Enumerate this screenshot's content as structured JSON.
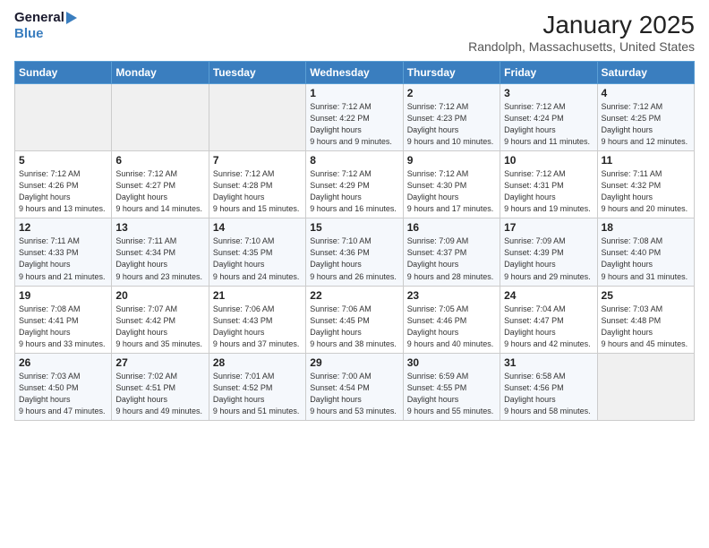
{
  "header": {
    "logo_general": "General",
    "logo_blue": "Blue",
    "month": "January 2025",
    "location": "Randolph, Massachusetts, United States"
  },
  "days_of_week": [
    "Sunday",
    "Monday",
    "Tuesday",
    "Wednesday",
    "Thursday",
    "Friday",
    "Saturday"
  ],
  "weeks": [
    [
      {
        "day": "",
        "empty": true
      },
      {
        "day": "",
        "empty": true
      },
      {
        "day": "",
        "empty": true
      },
      {
        "day": "1",
        "sunrise": "7:12 AM",
        "sunset": "4:22 PM",
        "daylight": "9 hours and 9 minutes."
      },
      {
        "day": "2",
        "sunrise": "7:12 AM",
        "sunset": "4:23 PM",
        "daylight": "9 hours and 10 minutes."
      },
      {
        "day": "3",
        "sunrise": "7:12 AM",
        "sunset": "4:24 PM",
        "daylight": "9 hours and 11 minutes."
      },
      {
        "day": "4",
        "sunrise": "7:12 AM",
        "sunset": "4:25 PM",
        "daylight": "9 hours and 12 minutes."
      }
    ],
    [
      {
        "day": "5",
        "sunrise": "7:12 AM",
        "sunset": "4:26 PM",
        "daylight": "9 hours and 13 minutes."
      },
      {
        "day": "6",
        "sunrise": "7:12 AM",
        "sunset": "4:27 PM",
        "daylight": "9 hours and 14 minutes."
      },
      {
        "day": "7",
        "sunrise": "7:12 AM",
        "sunset": "4:28 PM",
        "daylight": "9 hours and 15 minutes."
      },
      {
        "day": "8",
        "sunrise": "7:12 AM",
        "sunset": "4:29 PM",
        "daylight": "9 hours and 16 minutes."
      },
      {
        "day": "9",
        "sunrise": "7:12 AM",
        "sunset": "4:30 PM",
        "daylight": "9 hours and 17 minutes."
      },
      {
        "day": "10",
        "sunrise": "7:12 AM",
        "sunset": "4:31 PM",
        "daylight": "9 hours and 19 minutes."
      },
      {
        "day": "11",
        "sunrise": "7:11 AM",
        "sunset": "4:32 PM",
        "daylight": "9 hours and 20 minutes."
      }
    ],
    [
      {
        "day": "12",
        "sunrise": "7:11 AM",
        "sunset": "4:33 PM",
        "daylight": "9 hours and 21 minutes."
      },
      {
        "day": "13",
        "sunrise": "7:11 AM",
        "sunset": "4:34 PM",
        "daylight": "9 hours and 23 minutes."
      },
      {
        "day": "14",
        "sunrise": "7:10 AM",
        "sunset": "4:35 PM",
        "daylight": "9 hours and 24 minutes."
      },
      {
        "day": "15",
        "sunrise": "7:10 AM",
        "sunset": "4:36 PM",
        "daylight": "9 hours and 26 minutes."
      },
      {
        "day": "16",
        "sunrise": "7:09 AM",
        "sunset": "4:37 PM",
        "daylight": "9 hours and 28 minutes."
      },
      {
        "day": "17",
        "sunrise": "7:09 AM",
        "sunset": "4:39 PM",
        "daylight": "9 hours and 29 minutes."
      },
      {
        "day": "18",
        "sunrise": "7:08 AM",
        "sunset": "4:40 PM",
        "daylight": "9 hours and 31 minutes."
      }
    ],
    [
      {
        "day": "19",
        "sunrise": "7:08 AM",
        "sunset": "4:41 PM",
        "daylight": "9 hours and 33 minutes."
      },
      {
        "day": "20",
        "sunrise": "7:07 AM",
        "sunset": "4:42 PM",
        "daylight": "9 hours and 35 minutes."
      },
      {
        "day": "21",
        "sunrise": "7:06 AM",
        "sunset": "4:43 PM",
        "daylight": "9 hours and 37 minutes."
      },
      {
        "day": "22",
        "sunrise": "7:06 AM",
        "sunset": "4:45 PM",
        "daylight": "9 hours and 38 minutes."
      },
      {
        "day": "23",
        "sunrise": "7:05 AM",
        "sunset": "4:46 PM",
        "daylight": "9 hours and 40 minutes."
      },
      {
        "day": "24",
        "sunrise": "7:04 AM",
        "sunset": "4:47 PM",
        "daylight": "9 hours and 42 minutes."
      },
      {
        "day": "25",
        "sunrise": "7:03 AM",
        "sunset": "4:48 PM",
        "daylight": "9 hours and 45 minutes."
      }
    ],
    [
      {
        "day": "26",
        "sunrise": "7:03 AM",
        "sunset": "4:50 PM",
        "daylight": "9 hours and 47 minutes."
      },
      {
        "day": "27",
        "sunrise": "7:02 AM",
        "sunset": "4:51 PM",
        "daylight": "9 hours and 49 minutes."
      },
      {
        "day": "28",
        "sunrise": "7:01 AM",
        "sunset": "4:52 PM",
        "daylight": "9 hours and 51 minutes."
      },
      {
        "day": "29",
        "sunrise": "7:00 AM",
        "sunset": "4:54 PM",
        "daylight": "9 hours and 53 minutes."
      },
      {
        "day": "30",
        "sunrise": "6:59 AM",
        "sunset": "4:55 PM",
        "daylight": "9 hours and 55 minutes."
      },
      {
        "day": "31",
        "sunrise": "6:58 AM",
        "sunset": "4:56 PM",
        "daylight": "9 hours and 58 minutes."
      },
      {
        "day": "",
        "empty": true
      }
    ]
  ],
  "labels": {
    "sunrise": "Sunrise:",
    "sunset": "Sunset:",
    "daylight": "Daylight hours"
  }
}
